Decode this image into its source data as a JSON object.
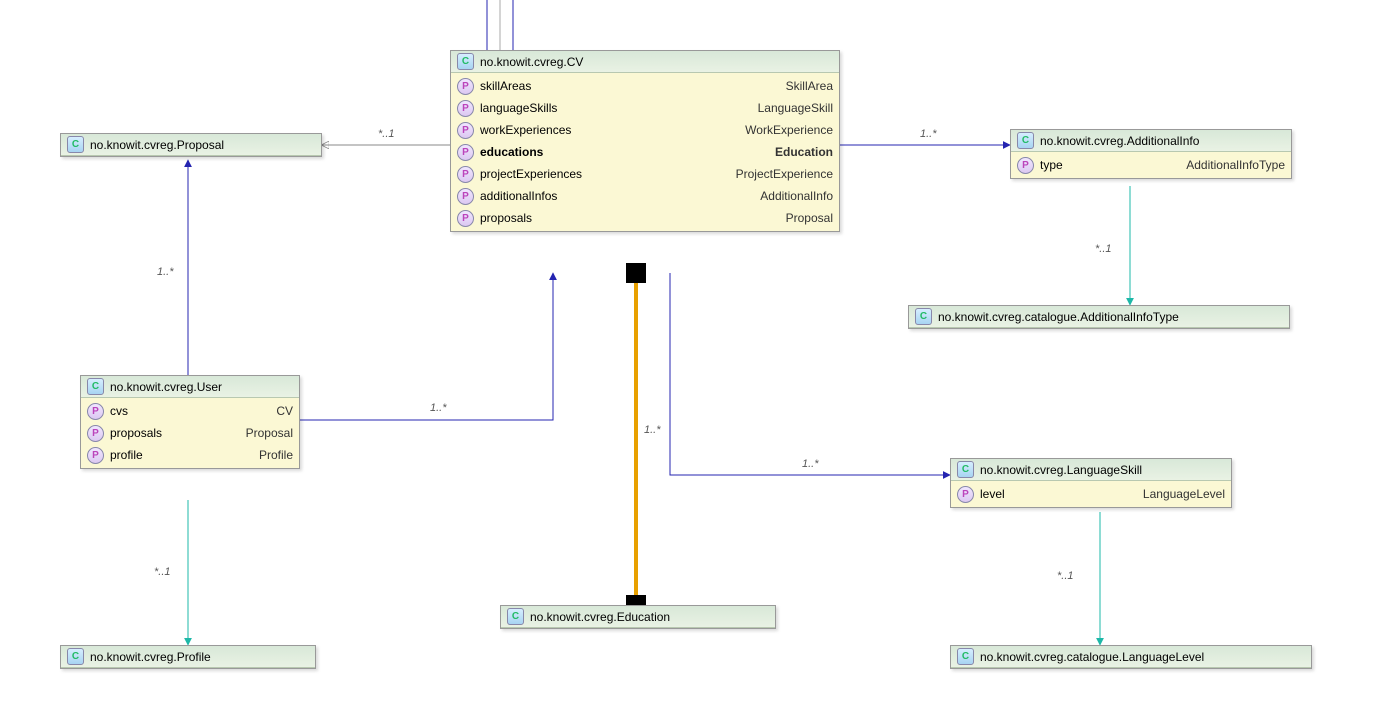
{
  "classes": {
    "proposal": {
      "title": "no.knowit.cvreg.Proposal"
    },
    "cv": {
      "title": "no.knowit.cvreg.CV",
      "props": [
        {
          "n": "skillAreas",
          "t": "SkillArea"
        },
        {
          "n": "languageSkills",
          "t": "LanguageSkill"
        },
        {
          "n": "workExperiences",
          "t": "WorkExperience"
        },
        {
          "n": "educations",
          "t": "Education",
          "b": true
        },
        {
          "n": "projectExperiences",
          "t": "ProjectExperience"
        },
        {
          "n": "additionalInfos",
          "t": "AdditionalInfo"
        },
        {
          "n": "proposals",
          "t": "Proposal"
        }
      ]
    },
    "addinfo": {
      "title": "no.knowit.cvreg.AdditionalInfo",
      "props": [
        {
          "n": "type",
          "t": "AdditionalInfoType"
        }
      ]
    },
    "addtype": {
      "title": "no.knowit.cvreg.catalogue.AdditionalInfoType"
    },
    "user": {
      "title": "no.knowit.cvreg.User",
      "props": [
        {
          "n": "cvs",
          "t": "CV"
        },
        {
          "n": "proposals",
          "t": "Proposal"
        },
        {
          "n": "profile",
          "t": "Profile"
        }
      ]
    },
    "profile": {
      "title": "no.knowit.cvreg.Profile"
    },
    "education": {
      "title": "no.knowit.cvreg.Education"
    },
    "langskill": {
      "title": "no.knowit.cvreg.LanguageSkill",
      "props": [
        {
          "n": "level",
          "t": "LanguageLevel"
        }
      ]
    },
    "langlevel": {
      "title": "no.knowit.cvreg.catalogue.LanguageLevel"
    }
  },
  "multiplicities": {
    "m1": "*..1",
    "m2": "1..*",
    "m3": "*..1",
    "m4": "1..*",
    "m5": "1..*",
    "m6": "*..1",
    "m7": "1..*",
    "m8": "*..1",
    "m9": "1..*"
  }
}
